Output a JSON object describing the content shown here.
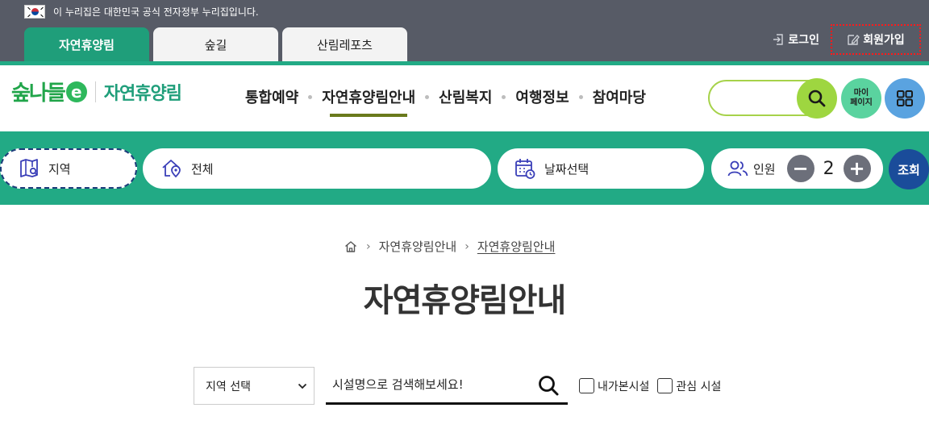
{
  "gov": {
    "notice": "이 누리집은 대한민국 공식 전자정부 누리집입니다."
  },
  "tabs": [
    {
      "label": "자연휴양림",
      "active": true
    },
    {
      "label": "숲길",
      "active": false
    },
    {
      "label": "산림레포츠",
      "active": false
    }
  ],
  "auth": {
    "login": "로그인",
    "signup": "회원가입"
  },
  "logo": {
    "brand": "숲나들e",
    "brand_main": "숲나들",
    "brand_e": "e",
    "site": "자연휴양림"
  },
  "gnb": [
    {
      "label": "통합예약",
      "active": false
    },
    {
      "label": "자연휴양림안내",
      "active": true
    },
    {
      "label": "산림복지",
      "active": false
    },
    {
      "label": "여행정보",
      "active": false
    },
    {
      "label": "참여마당",
      "active": false
    }
  ],
  "header_buttons": {
    "mypage_line1": "마이",
    "mypage_line2": "페이지"
  },
  "booking": {
    "region": "지역",
    "facility": "전체",
    "date": "날짜선택",
    "people_label": "인원",
    "people_count": "2",
    "minus": "−",
    "plus": "+",
    "lookup": "조회"
  },
  "breadcrumb": {
    "level1": "자연휴양림안내",
    "level2": "자연휴양림안내"
  },
  "page": {
    "title": "자연휴양림안내"
  },
  "filter": {
    "region_select": "지역 선택",
    "search_placeholder": "시설명으로 검색해보세요!",
    "check_visited": "내가본시설",
    "check_favorite": "관심 시설"
  },
  "colors": {
    "brand_green": "#22aa85",
    "tab_active": "#1f9e7a",
    "topbar": "#575b66",
    "lookup_blue": "#1a4c9a"
  }
}
